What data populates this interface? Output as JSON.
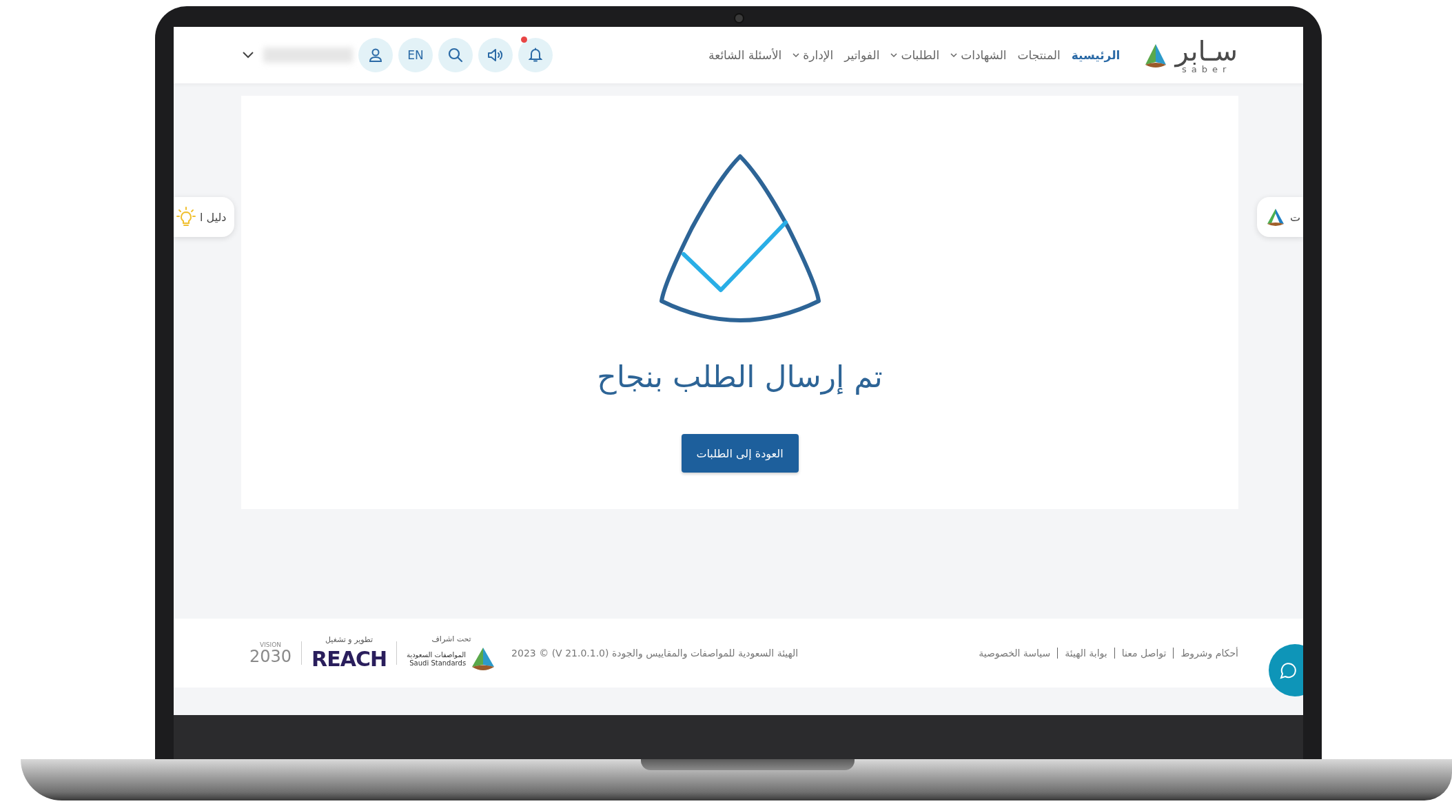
{
  "header": {
    "logo": {
      "text": "سـابر",
      "subtext": "saber"
    },
    "nav": [
      {
        "label": "الرئيسية",
        "selected": true,
        "dropdown": false
      },
      {
        "label": "المنتجات",
        "selected": false,
        "dropdown": false
      },
      {
        "label": "الشهادات",
        "selected": false,
        "dropdown": true
      },
      {
        "label": "الطلبات",
        "selected": false,
        "dropdown": true
      },
      {
        "label": "الفواتير",
        "selected": false,
        "dropdown": false
      },
      {
        "label": "الإدارة",
        "selected": false,
        "dropdown": true
      },
      {
        "label": "الأسئلة الشائعة",
        "selected": false,
        "dropdown": false
      }
    ],
    "actions": [
      {
        "kind": "bell",
        "notification": true
      },
      {
        "kind": "speaker"
      },
      {
        "kind": "search"
      },
      {
        "kind": "language",
        "label": "EN"
      },
      {
        "kind": "user"
      }
    ]
  },
  "side_tabs": {
    "left": "دليل ا",
    "right": "ت"
  },
  "success": {
    "title": "تم إرسال الطلب بنجاح",
    "button": "العودة إلى الطلبات"
  },
  "footer": {
    "links": [
      "أحكام وشروط",
      "تواصل معنا",
      "بوابة الهيئة",
      "سياسة الخصوصية"
    ],
    "copyright": "الهيئة السعودية للمواصفات والمقاييس والجودة (V 21.0.1.0) © 2023",
    "supervision_label": "تحت اشراف",
    "saso_arabic": "المواصفات السعودية",
    "saso_english": "Saudi Standards",
    "developer_label": "تطوير و تشغيل",
    "developer": "REACH",
    "vision_label": "VISION",
    "vision_year": "2030"
  }
}
